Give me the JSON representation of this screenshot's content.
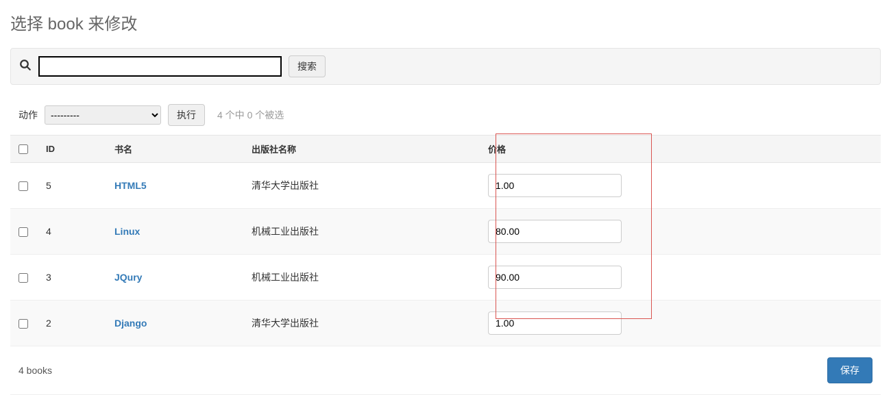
{
  "page_title": "选择 book 来修改",
  "search": {
    "value": "",
    "button_label": "搜索"
  },
  "actions": {
    "label": "动作",
    "select_placeholder": "---------",
    "go_label": "执行",
    "selection_counter": "4 个中 0 个被选"
  },
  "table": {
    "headers": {
      "id": "ID",
      "title": "书名",
      "publisher": "出版社名称",
      "price": "价格"
    },
    "rows": [
      {
        "id": "5",
        "title": "HTML5",
        "publisher": "清华大学出版社",
        "price": "1.00"
      },
      {
        "id": "4",
        "title": "Linux",
        "publisher": "机械工业出版社",
        "price": "80.00"
      },
      {
        "id": "3",
        "title": "JQury",
        "publisher": "机械工业出版社",
        "price": "90.00"
      },
      {
        "id": "2",
        "title": "Django",
        "publisher": "清华大学出版社",
        "price": "1.00"
      }
    ]
  },
  "footer": {
    "count_label": "4 books",
    "save_label": "保存"
  }
}
